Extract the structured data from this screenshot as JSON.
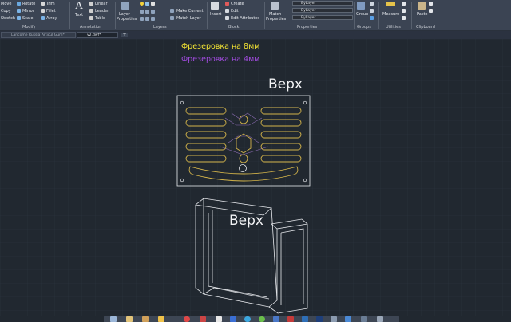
{
  "ribbon": {
    "modify": {
      "items": [
        {
          "label": "Move",
          "icon": "move-icon"
        },
        {
          "label": "Rotate",
          "icon": "rotate-icon"
        },
        {
          "label": "Trim",
          "icon": "trim-icon"
        },
        {
          "label": "Copy",
          "icon": "copy-icon"
        },
        {
          "label": "Mirror",
          "icon": "mirror-icon"
        },
        {
          "label": "Fillet",
          "icon": "fillet-icon"
        },
        {
          "label": "Stretch",
          "icon": "stretch-icon"
        },
        {
          "label": "Scale",
          "icon": "scale-icon"
        },
        {
          "label": "Array",
          "icon": "array-icon"
        }
      ],
      "panel_label": "Modify"
    },
    "annotation": {
      "text_label": "Text",
      "linear_label": "Linear",
      "leader_label": "Leader",
      "table_label": "Table",
      "panel_label": "Annotation"
    },
    "layers": {
      "layer_properties_line1": "Layer",
      "layer_properties_line2": "Properties",
      "make_current_label": "Make Current",
      "match_layer_label": "Match Layer",
      "panel_label": "Layers"
    },
    "block": {
      "insert_label": "Insert",
      "create_label": "Create",
      "edit_label": "Edit",
      "edit_attributes_label": "Edit Attributes",
      "panel_label": "Block"
    },
    "properties": {
      "match_line1": "Match",
      "match_line2": "Properties",
      "color_value": "ByLayer",
      "linetype_value": "ByLayer",
      "lineweight_value": "ByLayer",
      "panel_label": "Properties"
    },
    "groups": {
      "group_label": "Group",
      "panel_label": "Groups"
    },
    "utilities": {
      "measure_label": "Measure",
      "panel_label": "Utilities"
    },
    "clipboard": {
      "paste_label": "Paste",
      "panel_label": "Clipboard"
    }
  },
  "tabs": [
    {
      "label": "Lancome Russia Articul Gum*",
      "active": false
    },
    {
      "label": "v2.dwf*",
      "active": true
    }
  ],
  "drawing": {
    "legend": [
      {
        "text": "Фрезеровка на 8мм",
        "color": "#f5e633"
      },
      {
        "text": "Фрезеровка на 4мм",
        "color": "#a24be0"
      }
    ],
    "label_top_view": "Верх",
    "label_3d_view": "Верх"
  },
  "colors": {
    "background": "#212830",
    "ribbon": "#3b4453",
    "slot_outline": "#d4b44a",
    "line_white": "#e8eaee",
    "engrave_purple": "#8a6bb0"
  },
  "taskbar_icons": [
    "explorer-icon",
    "folder-icon",
    "chrome-icon",
    "ie-icon",
    "opera-icon",
    "app-icon",
    "word-icon",
    "skype-icon",
    "media-icon",
    "autocad-icon",
    "photoshop-icon",
    "ps-icon",
    "app2-icon",
    "app3-icon",
    "outlook-icon",
    "app4-icon",
    "app5-icon"
  ]
}
